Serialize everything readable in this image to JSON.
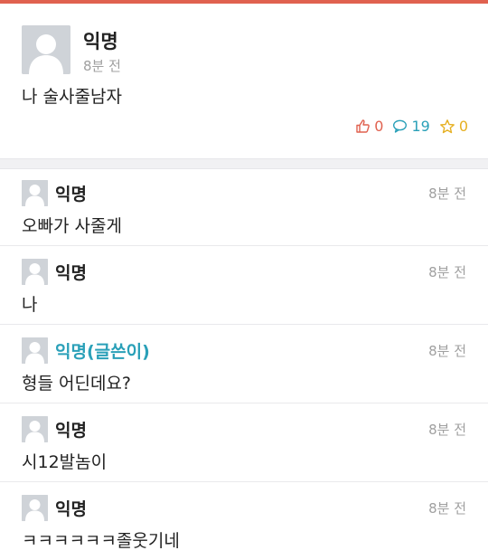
{
  "colors": {
    "accent": "#e0614f",
    "op": "#2aa0b8",
    "star": "#e6b022",
    "muted": "#a0a0a0"
  },
  "post": {
    "author": "익명",
    "time": "8분 전",
    "body": "나 술사줄남자",
    "likes": "0",
    "comments": "19",
    "scraps": "0"
  },
  "comments": [
    {
      "author": "익명",
      "time": "8분 전",
      "body": "오빠가 사줄게",
      "is_op": false
    },
    {
      "author": "익명",
      "time": "8분 전",
      "body": "나",
      "is_op": false
    },
    {
      "author": "익명(글쓴이)",
      "time": "8분 전",
      "body": "형들 어딘데요?",
      "is_op": true
    },
    {
      "author": "익명",
      "time": "8분 전",
      "body": "시12발놈이",
      "is_op": false
    },
    {
      "author": "익명",
      "time": "8분 전",
      "body": "ㅋㅋㅋㅋㅋㅋ졸웃기네",
      "is_op": false
    }
  ]
}
